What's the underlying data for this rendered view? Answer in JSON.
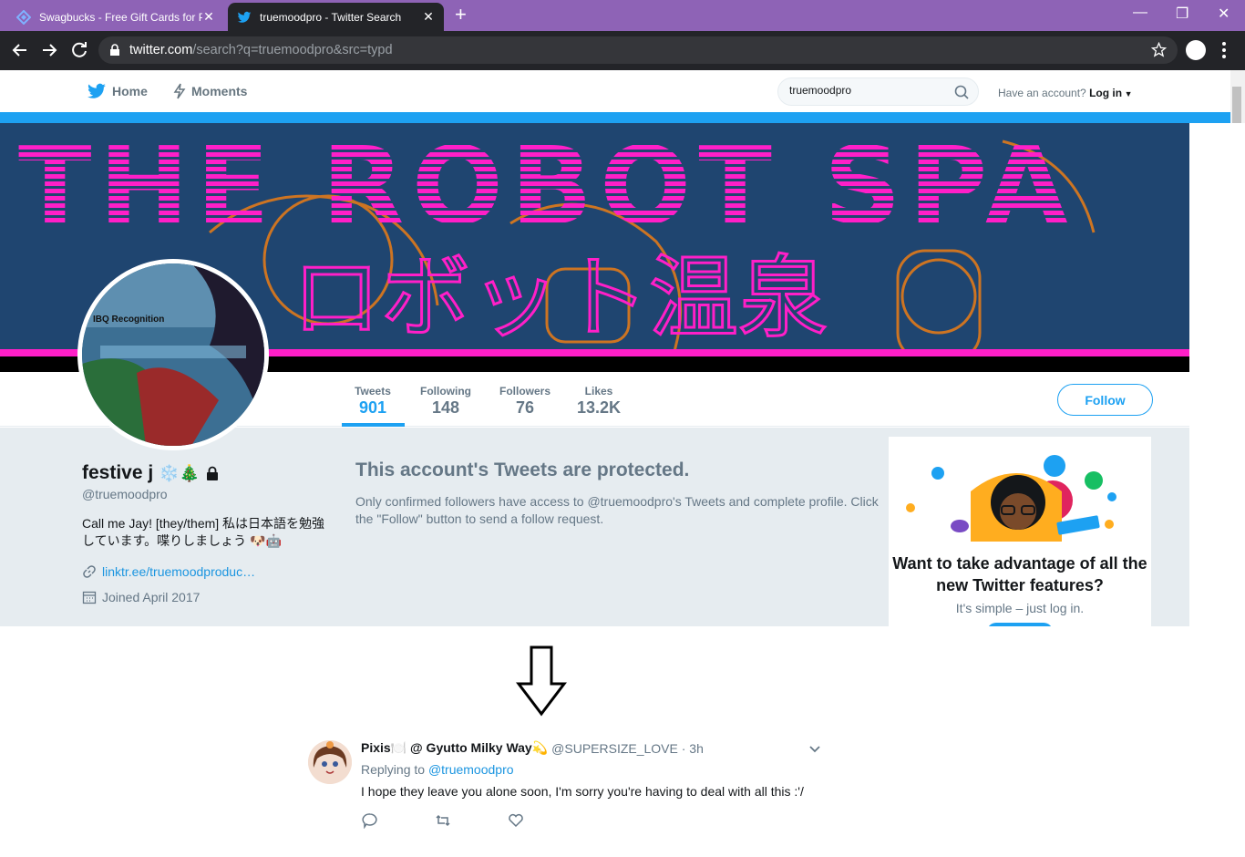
{
  "browser": {
    "tabs": [
      {
        "title": "Swagbucks - Free Gift Cards for P",
        "icon": "swagbucks-icon",
        "active": false
      },
      {
        "title": "truemoodpro - Twitter Search",
        "icon": "twitter-icon",
        "active": true
      }
    ],
    "url_host": "twitter.com",
    "url_path": "/search?q=truemoodpro&src=typd"
  },
  "twitter_nav": {
    "home_label": "Home",
    "moments_label": "Moments",
    "search_value": "truemoodpro",
    "have_account": "Have an account?",
    "login_label": "Log in"
  },
  "banner": {
    "title_text": "THE ROBOT SPA",
    "japanese_text": "ロボット温泉"
  },
  "avatar": {
    "caption": "IBQ Recognition"
  },
  "stats": [
    {
      "label": "Tweets",
      "value": "901",
      "active": true
    },
    {
      "label": "Following",
      "value": "148",
      "active": false
    },
    {
      "label": "Followers",
      "value": "76",
      "active": false
    },
    {
      "label": "Likes",
      "value": "13.2K",
      "active": false
    }
  ],
  "follow_label": "Follow",
  "profile": {
    "name": "festive j",
    "name_emoji": "❄️🎄",
    "handle": "@truemoodpro",
    "bio": "Call me Jay! [they/them] 私は日本語を勉強しています。喋りしましょう 🐶🤖",
    "link": "linktr.ee/truemoodproduc…",
    "joined": "Joined April 2017"
  },
  "protected": {
    "title": "This account's Tweets are protected.",
    "text": "Only confirmed followers have access to @truemoodpro's Tweets and complete profile. Click the \"Follow\" button to send a follow request."
  },
  "signup_card": {
    "title": "Want to take advantage of all the new Twitter features?",
    "subtitle": "It's simple – just log in."
  },
  "reply_tweet": {
    "name": "Pixis🍽️ @ Gyutto Milky Way💫",
    "handle_time": "@SUPERSIZE_LOVE · 3h",
    "replying_prefix": "Replying to",
    "replying_to": "@truemoodpro",
    "text": "I hope they leave you alone soon, I'm sorry you're having to deal with all this :'/"
  },
  "colors": {
    "twitter_blue": "#1da1f2",
    "tab_bar": "#8e63b6",
    "banner_magenta": "#ff1fc8"
  }
}
